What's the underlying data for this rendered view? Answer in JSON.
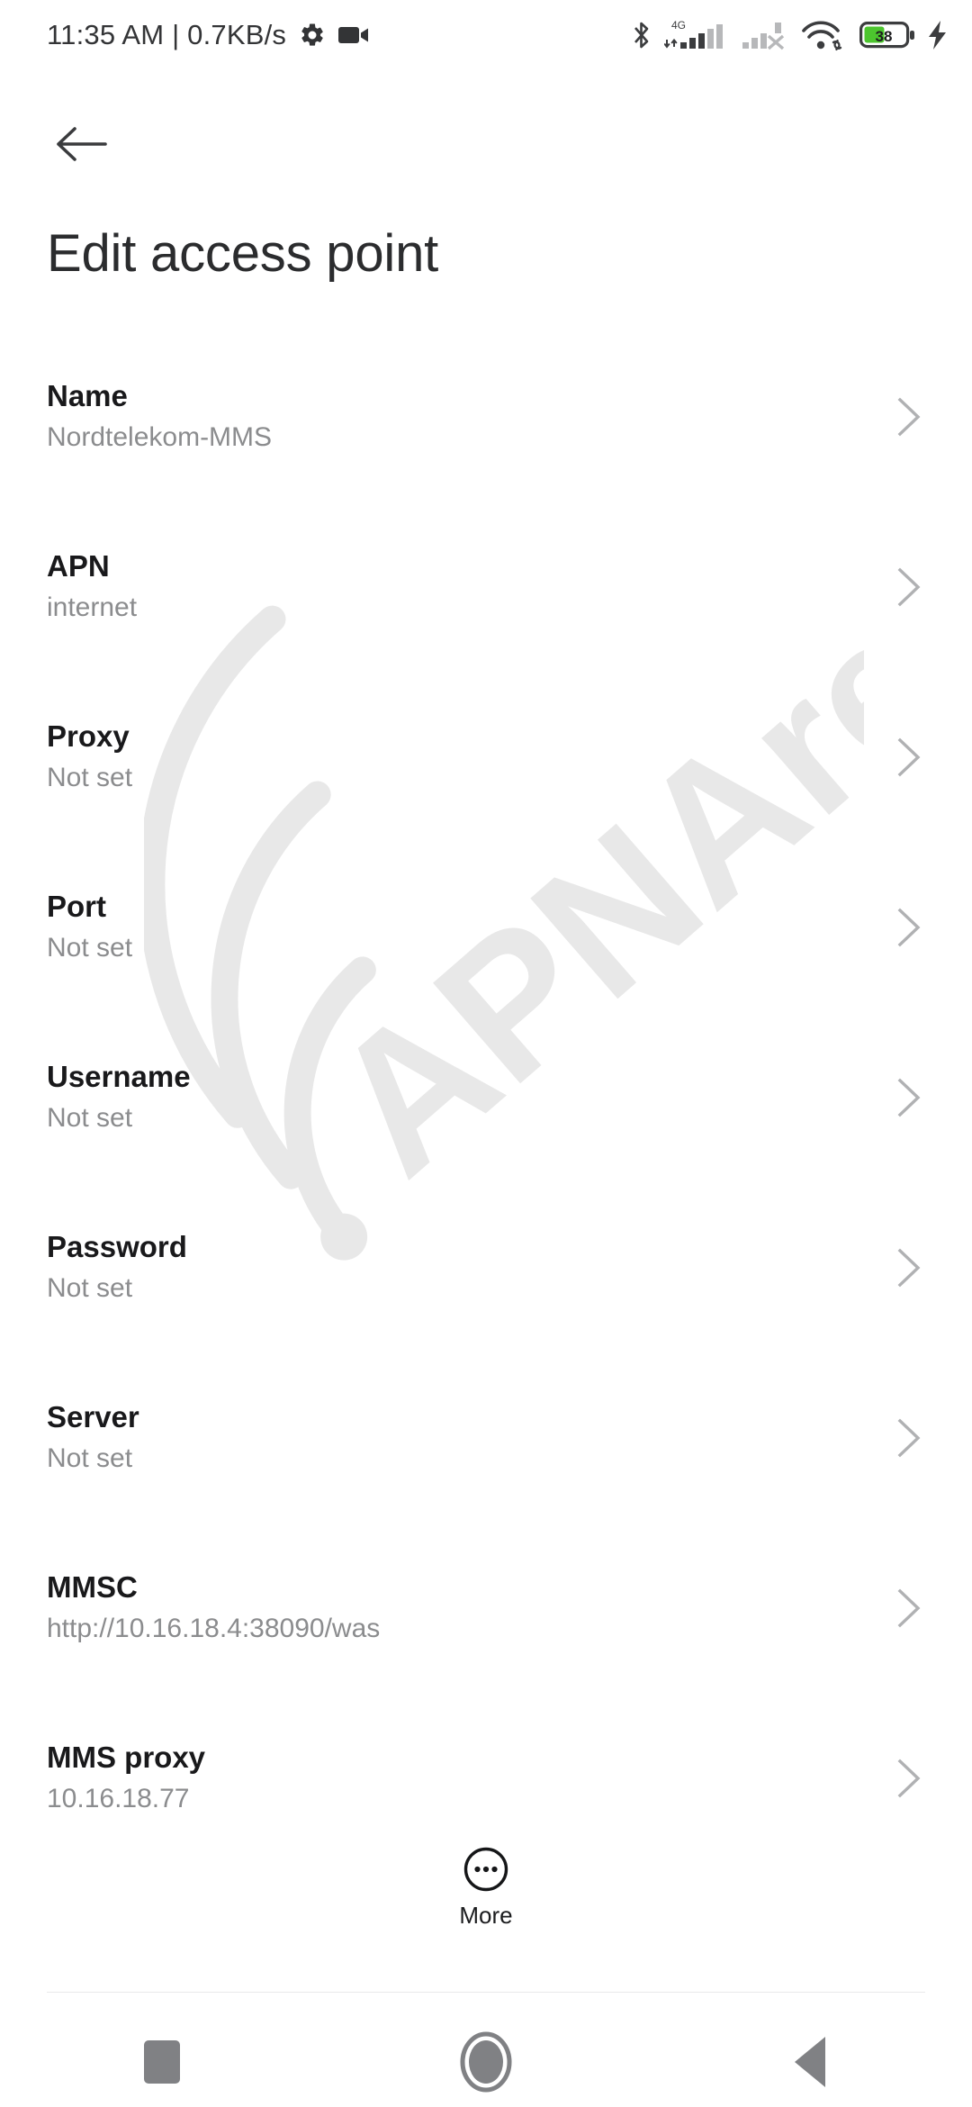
{
  "status_bar": {
    "clock": "11:35 AM | 0.7KB/s",
    "icons_left": [
      "gear-icon",
      "video-camera-icon"
    ],
    "icons_right": [
      "bluetooth-icon",
      "signal-4g-icon",
      "signal-no-service-icon",
      "wifi-icon",
      "battery-icon",
      "charging-bolt-icon"
    ],
    "network_type": "4G",
    "battery_percent": "38",
    "colors": {
      "text": "#333436",
      "battery_fill": "#4CC52E",
      "signal_active": "#3c3d3f",
      "signal_inactive": "#b7b8ba"
    }
  },
  "header": {
    "back_icon": "arrow-left-icon",
    "title": "Edit access point"
  },
  "settings": {
    "chevron_icon": "chevron-right-icon",
    "rows": [
      {
        "label": "Name",
        "value": "Nordtelekom-MMS"
      },
      {
        "label": "APN",
        "value": "internet"
      },
      {
        "label": "Proxy",
        "value": "Not set"
      },
      {
        "label": "Port",
        "value": "Not set"
      },
      {
        "label": "Username",
        "value": "Not set"
      },
      {
        "label": "Password",
        "value": "Not set"
      },
      {
        "label": "Server",
        "value": "Not set"
      },
      {
        "label": "MMSC",
        "value": "http://10.16.18.4:38090/was"
      },
      {
        "label": "MMS proxy",
        "value": "10.16.18.77"
      }
    ]
  },
  "more": {
    "icon": "more-circle-icon",
    "label": "More"
  },
  "watermark": {
    "text": "APNArena",
    "color": "#e8e8e8"
  },
  "nav_bar": {
    "recents_icon": "square-icon",
    "home_icon": "circle-icon",
    "back_icon": "triangle-left-icon",
    "color": "#808184"
  }
}
